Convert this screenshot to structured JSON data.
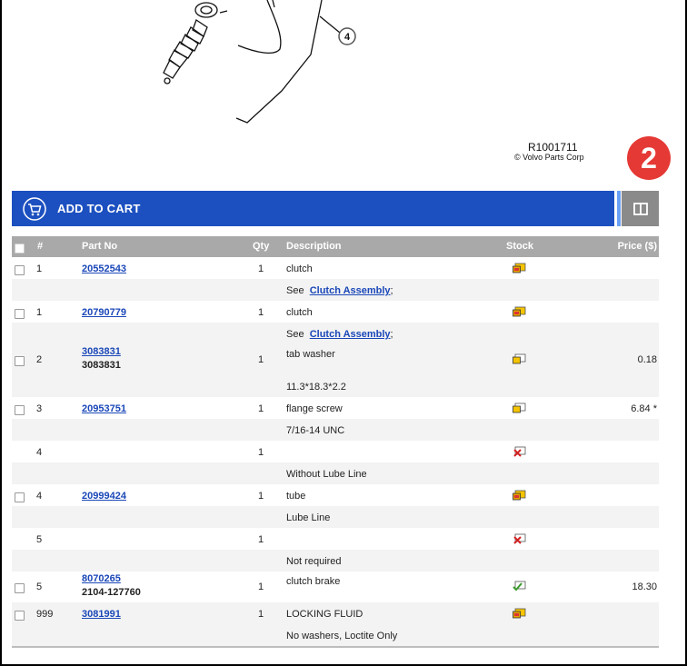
{
  "illustration": {
    "callout": "4",
    "reference": "R1001711",
    "copyright": "© Volvo Parts Corp"
  },
  "step_badge": "2",
  "toolbar": {
    "add_to_cart": "ADD TO CART",
    "cart_icon": "shopping-cart-icon",
    "view_icon": "split-view-icon"
  },
  "table": {
    "headers": {
      "num": "#",
      "part_no": "Part No",
      "qty": "Qty",
      "description": "Description",
      "stock": "Stock",
      "price": "Price ($)"
    },
    "rows": [
      {
        "num": "1",
        "part_no": "20552543",
        "qty": "1",
        "description": "clutch",
        "stock": "in-stock-partial-icon",
        "price": "",
        "note_prefix": "See",
        "note_link": "Clutch Assembly",
        "note_suffix": ";"
      },
      {
        "num": "1",
        "part_no": "20790779",
        "qty": "1",
        "description": "clutch",
        "stock": "in-stock-partial-icon",
        "price": "",
        "note_prefix": "See",
        "note_link": "Clutch Assembly",
        "note_suffix": ";"
      },
      {
        "num": "2",
        "part_no": "3083831",
        "alt_no": "3083831",
        "qty": "1",
        "description": "tab washer",
        "stock": "order-icon",
        "price": "0.18",
        "note": "11.3*18.3*2.2"
      },
      {
        "num": "3",
        "part_no": "20953751",
        "qty": "1",
        "description": "flange screw",
        "stock": "order-icon",
        "price": "6.84 *",
        "note": "7/16-14 UNC"
      },
      {
        "num": "4",
        "part_no": "",
        "qty": "1",
        "description": "",
        "stock": "unavailable-icon",
        "price": "",
        "note": "Without Lube Line"
      },
      {
        "num": "4",
        "part_no": "20999424",
        "qty": "1",
        "description": "tube",
        "stock": "in-stock-partial-icon",
        "price": "",
        "note": "Lube Line"
      },
      {
        "num": "5",
        "part_no": "",
        "qty": "1",
        "description": "",
        "stock": "unavailable-icon",
        "price": "",
        "note": "Not required"
      },
      {
        "num": "5",
        "part_no": "8070265",
        "alt_no": "2104-127760",
        "qty": "1",
        "description": "clutch brake",
        "stock": "in-stock-icon",
        "price": "18.30"
      },
      {
        "num": "999",
        "part_no": "3081991",
        "qty": "1",
        "description": "LOCKING FLUID",
        "stock": "in-stock-partial-icon",
        "price": "",
        "note": "No washers, Loctite Only"
      }
    ]
  }
}
